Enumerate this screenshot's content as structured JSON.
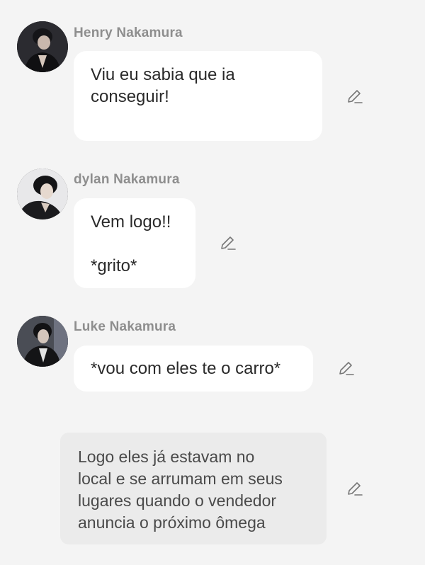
{
  "messages": [
    {
      "sender": "Henry Nakamura",
      "text": "Viu eu sabia que ia\nconseguir!",
      "avatar": "avatar-henry"
    },
    {
      "sender": "dylan Nakamura",
      "text": "Vem logo!!\n\n*grito*",
      "avatar": "avatar-dylan"
    },
    {
      "sender": "Luke Nakamura",
      "text": "*vou com eles te o carro*",
      "avatar": "avatar-luke"
    }
  ],
  "narration": {
    "text": "Logo eles já estavam no\nlocal e se arrumam em seus\nlugares quando o vendedor\nanuncia o próximo ômega"
  },
  "icons": {
    "edit": "pencil-icon"
  },
  "colors": {
    "background": "#f4f4f4",
    "bubble": "#ffffff",
    "narration_bubble": "#ebebeb",
    "sender_name": "#8e8e8e",
    "text": "#2a2a2a"
  }
}
